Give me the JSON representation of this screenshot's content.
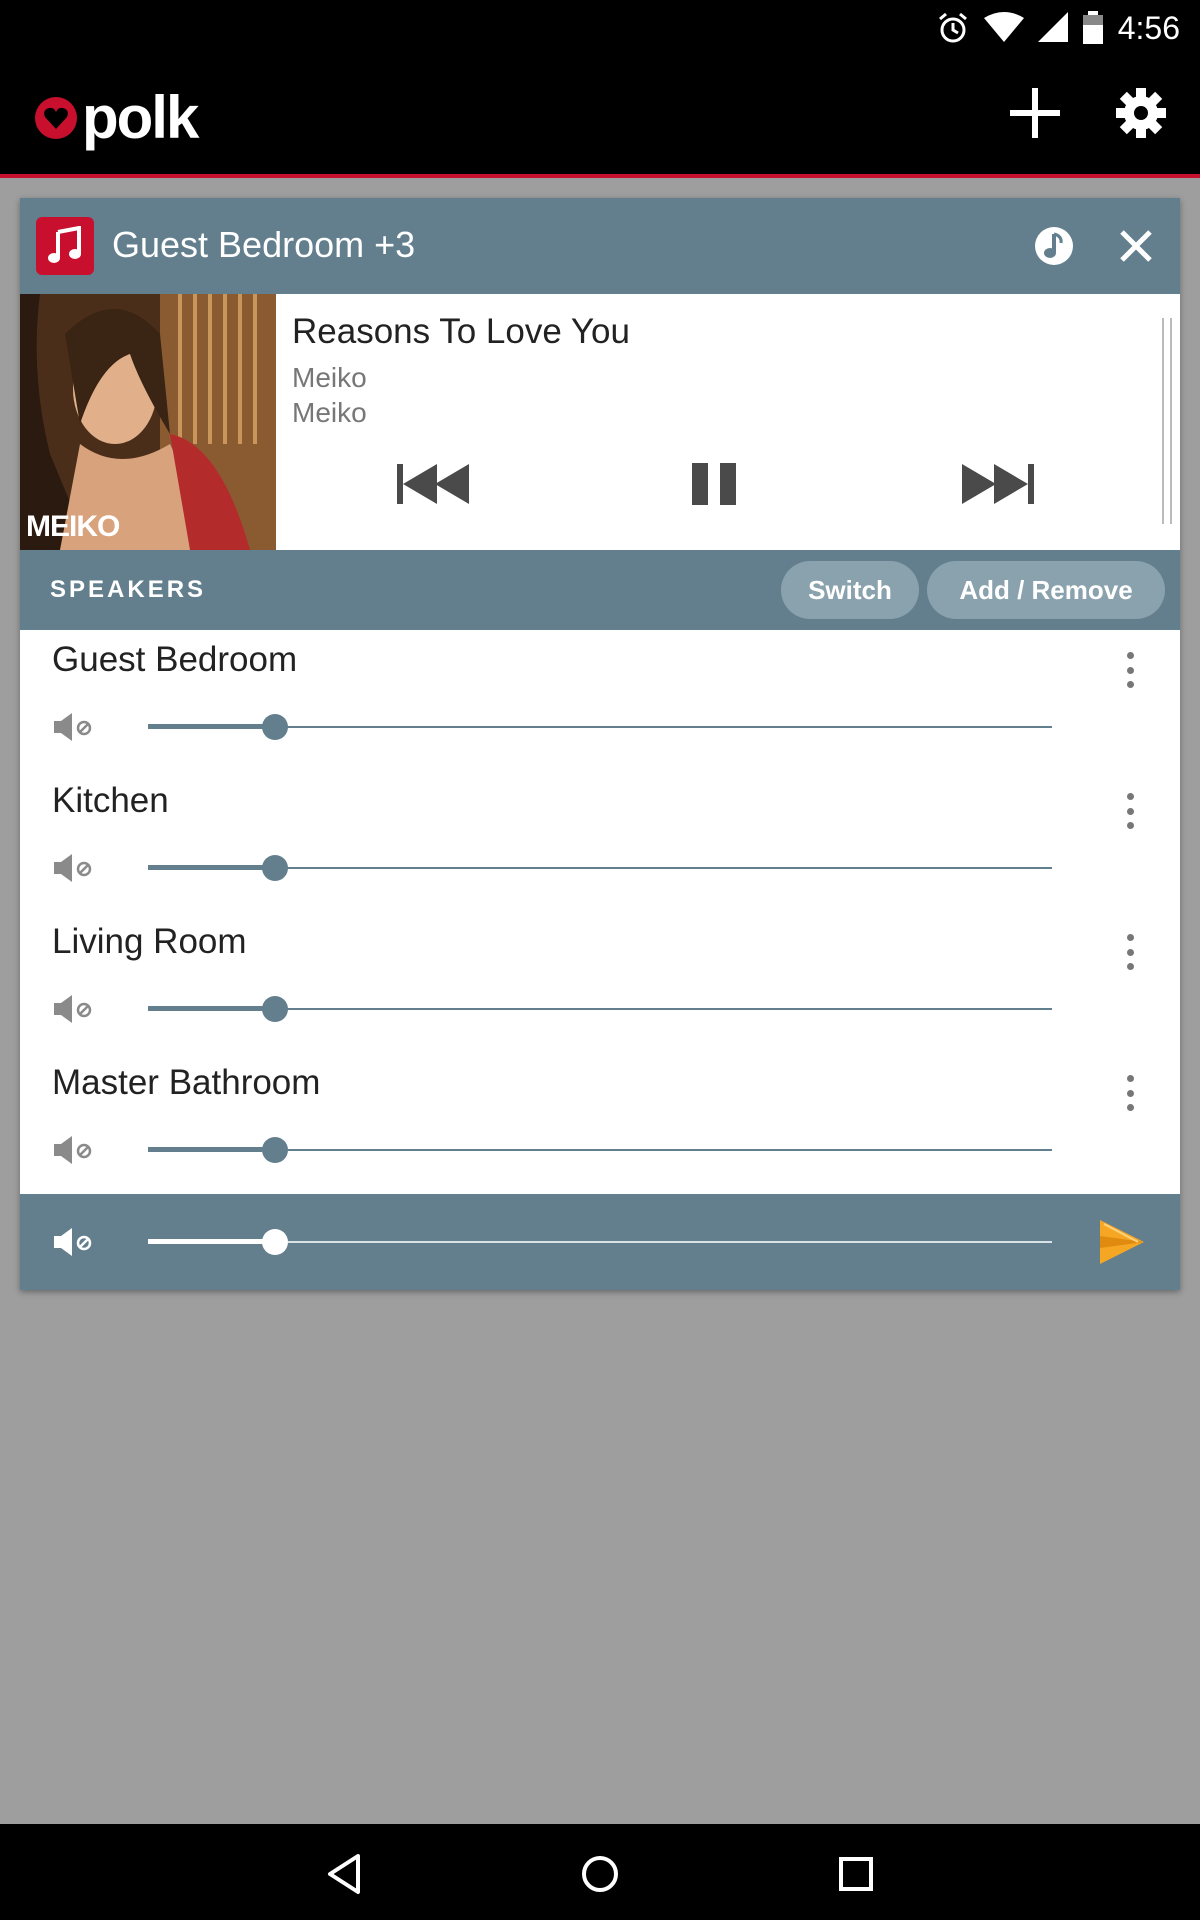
{
  "status_bar": {
    "time": "4:56",
    "icons": [
      "alarm-icon",
      "wifi-icon",
      "cell-signal-icon",
      "battery-icon"
    ]
  },
  "app_bar": {
    "logo_text": "polk",
    "actions": [
      "add-icon",
      "settings-icon"
    ]
  },
  "zone": {
    "title": "Guest Bedroom +3",
    "source_icon": "music-note-icon"
  },
  "now_playing": {
    "track": "Reasons To Love You",
    "artist": "Meiko",
    "album": "Meiko",
    "album_art_label": "MEIKO",
    "controls": [
      "previous-icon",
      "pause-icon",
      "next-icon"
    ]
  },
  "speakers_section": {
    "label": "SPEAKERS",
    "switch_label": "Switch",
    "add_remove_label": "Add / Remove"
  },
  "speakers": [
    {
      "name": "Guest Bedroom",
      "volume": 0.14,
      "muted": true
    },
    {
      "name": "Kitchen",
      "volume": 0.14,
      "muted": true
    },
    {
      "name": "Living Room",
      "volume": 0.14,
      "muted": true
    },
    {
      "name": "Master Bathroom",
      "volume": 0.14,
      "muted": true
    }
  ],
  "master": {
    "volume": 0.14,
    "muted": true
  },
  "colors": {
    "accent": "#c8102e",
    "panel": "#637f8e",
    "play": "#f5a623"
  }
}
